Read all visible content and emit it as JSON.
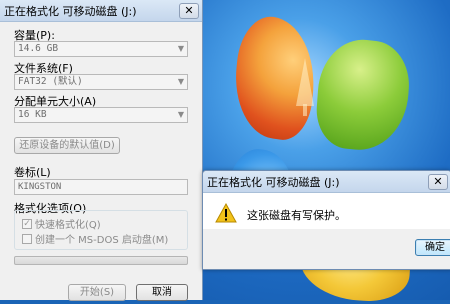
{
  "format_dialog": {
    "title": "正在格式化 可移动磁盘 (J:)",
    "close_glyph": "✕",
    "capacity_label": "容量(P):",
    "capacity_value": "14.6 GB",
    "filesystem_label": "文件系统(F)",
    "filesystem_value": "FAT32 (默认)",
    "allocation_label": "分配单元大小(A)",
    "allocation_value": "16 KB",
    "restore_defaults_label": "还原设备的默认值(D)",
    "volume_label_label": "卷标(L)",
    "volume_label_value": "KINGSTON",
    "format_options_label": "格式化选项(O)",
    "quick_format_label": "快速格式化(Q)",
    "quick_format_checked": true,
    "msdos_boot_label": "创建一个 MS-DOS 启动盘(M)",
    "msdos_boot_checked": false,
    "start_label": "开始(S)",
    "cancel_label": "取消",
    "progress": 0.0
  },
  "message_dialog": {
    "title": "正在格式化 可移动磁盘 (J:)",
    "close_glyph": "✕",
    "message": "这张磁盘有写保护。",
    "icon": "warning-icon",
    "confirm_label": "确定"
  },
  "colors": {
    "titlebar": "#c4d6ec",
    "window_bg": "#f0f0f0",
    "warning_yellow": "#f2c21a"
  }
}
